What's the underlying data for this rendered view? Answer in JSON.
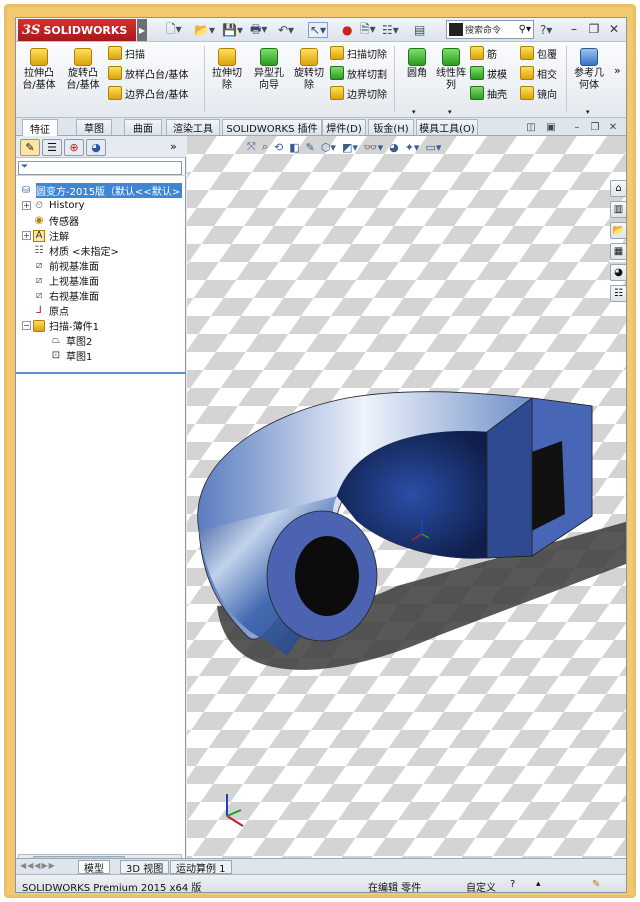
{
  "app": {
    "brand": "SOLIDWORKS",
    "brand_prefix": "3S",
    "search_placeholder": "搜索命令"
  },
  "ribbon": {
    "extrude_boss": "拉伸凸\n台/基体",
    "revolve_boss": "旋转凸\n台/基体",
    "sweep": "扫描",
    "loft_boss": "放样凸台/基体",
    "boundary_boss": "边界凸台/基体",
    "extrude_cut": "拉伸切\n除",
    "hole_wizard": "异型孔\n向导",
    "revolve_cut": "旋转切\n除",
    "sweep_cut": "扫描切除",
    "loft_cut": "放样切割",
    "boundary_cut": "边界切除",
    "fillet": "圆角",
    "linear_pattern": "线性阵\n列",
    "rib": "筋",
    "draft": "拔模",
    "shell": "抽壳",
    "wrap": "包覆",
    "intersect": "相交",
    "mirror": "镜向",
    "ref_geometry": "参考几\n何体"
  },
  "tabs": [
    "特征",
    "草图",
    "曲面",
    "渲染工具",
    "SOLIDWORKS 插件",
    "焊件(D)",
    "钣金(H)",
    "模具工具(O)"
  ],
  "tree": {
    "root": "圆变方-2015版（默认<<默认>",
    "history": "History",
    "sensors": "传感器",
    "annotations": "注解",
    "material": "材质 <未指定>",
    "front_plane": "前视基准面",
    "top_plane": "上视基准面",
    "right_plane": "右视基准面",
    "origin": "原点",
    "sweep_thin": "扫描-薄件1",
    "sketch2": "草图2",
    "sketch1": "草图1"
  },
  "model_tabs": [
    "模型",
    "3D 视图",
    "运动算例 1"
  ],
  "status": {
    "product": "SOLIDWORKS Premium 2015 x64 版",
    "mode": "在编辑 零件",
    "units": "自定义",
    "help": "?"
  }
}
